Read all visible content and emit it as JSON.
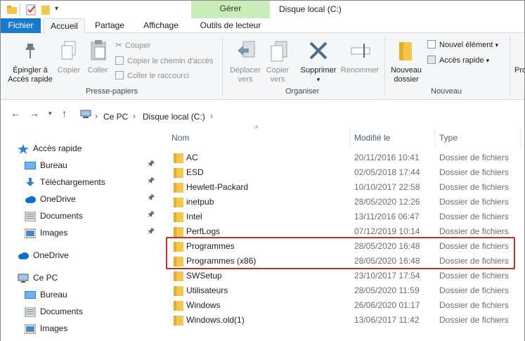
{
  "window": {
    "title": "Disque local (C:)",
    "contextual_tab": "Gérer"
  },
  "tabs": [
    {
      "label": "Fichier"
    },
    {
      "label": "Accueil"
    },
    {
      "label": "Partage"
    },
    {
      "label": "Affichage"
    },
    {
      "label": "Outils de lecteur"
    }
  ],
  "ribbon": {
    "clipboard": {
      "group_label": "Presse-papiers",
      "pin_label_1": "Épingler à",
      "pin_label_2": "Accès rapide",
      "copy": "Copier",
      "paste": "Coller",
      "cut": "Couper",
      "copy_path": "Copier le chemin d'accès",
      "paste_shortcut": "Coller le raccourci"
    },
    "organize": {
      "group_label": "Organiser",
      "move_1": "Déplacer",
      "move_2": "vers",
      "copyto_1": "Copier",
      "copyto_2": "vers",
      "delete": "Supprimer",
      "rename": "Renommer"
    },
    "new": {
      "group_label": "Nouveau",
      "folder_1": "Nouveau",
      "folder_2": "dossier",
      "new_item": "Nouvel élément",
      "quick_access": "Accès rapide"
    },
    "truncated_label": "Pro"
  },
  "address": {
    "crumbs": [
      "Ce PC",
      "Disque local (C:)"
    ]
  },
  "columns": {
    "name": "Nom",
    "modified": "Modifié le",
    "type": "Type"
  },
  "navpane": [
    {
      "label": "Accès rapide",
      "icon": "star-icon",
      "indent": 1,
      "pinned": false
    },
    {
      "label": "Bureau",
      "icon": "desktop-icon",
      "indent": 2,
      "pinned": true
    },
    {
      "label": "Téléchargements",
      "icon": "download-icon",
      "indent": 2,
      "pinned": true
    },
    {
      "label": "OneDrive",
      "icon": "cloud-icon",
      "indent": 2,
      "pinned": true
    },
    {
      "label": "Documents",
      "icon": "documents-icon",
      "indent": 2,
      "pinned": true
    },
    {
      "label": "Images",
      "icon": "images-icon",
      "indent": 2,
      "pinned": true
    },
    {
      "label": "OneDrive",
      "icon": "cloud-icon",
      "indent": 1,
      "pinned": false
    },
    {
      "label": "Ce PC",
      "icon": "computer-icon",
      "indent": 1,
      "pinned": false
    },
    {
      "label": "Bureau",
      "icon": "desktop-icon",
      "indent": 2,
      "pinned": false
    },
    {
      "label": "Documents",
      "icon": "documents-icon",
      "indent": 2,
      "pinned": false
    },
    {
      "label": "Images",
      "icon": "images-icon",
      "indent": 2,
      "pinned": false
    }
  ],
  "files": [
    {
      "name": "AC",
      "modified": "20/11/2016 10:41",
      "type": "Dossier de fichiers"
    },
    {
      "name": "ESD",
      "modified": "02/05/2018 17:44",
      "type": "Dossier de fichiers"
    },
    {
      "name": "Hewlett-Packard",
      "modified": "10/10/2017 22:58",
      "type": "Dossier de fichiers"
    },
    {
      "name": "inetpub",
      "modified": "28/05/2020 12:26",
      "type": "Dossier de fichiers"
    },
    {
      "name": "Intel",
      "modified": "13/11/2016 06:47",
      "type": "Dossier de fichiers"
    },
    {
      "name": "PerfLogs",
      "modified": "07/12/2019 10:14",
      "type": "Dossier de fichiers"
    },
    {
      "name": "Programmes",
      "modified": "28/05/2020 16:48",
      "type": "Dossier de fichiers"
    },
    {
      "name": "Programmes (x86)",
      "modified": "28/05/2020 16:48",
      "type": "Dossier de fichiers"
    },
    {
      "name": "SWSetup",
      "modified": "23/10/2017 17:54",
      "type": "Dossier de fichiers"
    },
    {
      "name": "Utilisateurs",
      "modified": "28/05/2020 11:59",
      "type": "Dossier de fichiers"
    },
    {
      "name": "Windows",
      "modified": "26/06/2020 01:17",
      "type": "Dossier de fichiers"
    },
    {
      "name": "Windows.old(1)",
      "modified": "13/06/2017 11:42",
      "type": "Dossier de fichiers"
    }
  ],
  "colors": {
    "accent": "#1979ca",
    "folder": "#f4c64e",
    "highlight": "#c62d2d",
    "manage_tab": "#c9ecb9"
  }
}
